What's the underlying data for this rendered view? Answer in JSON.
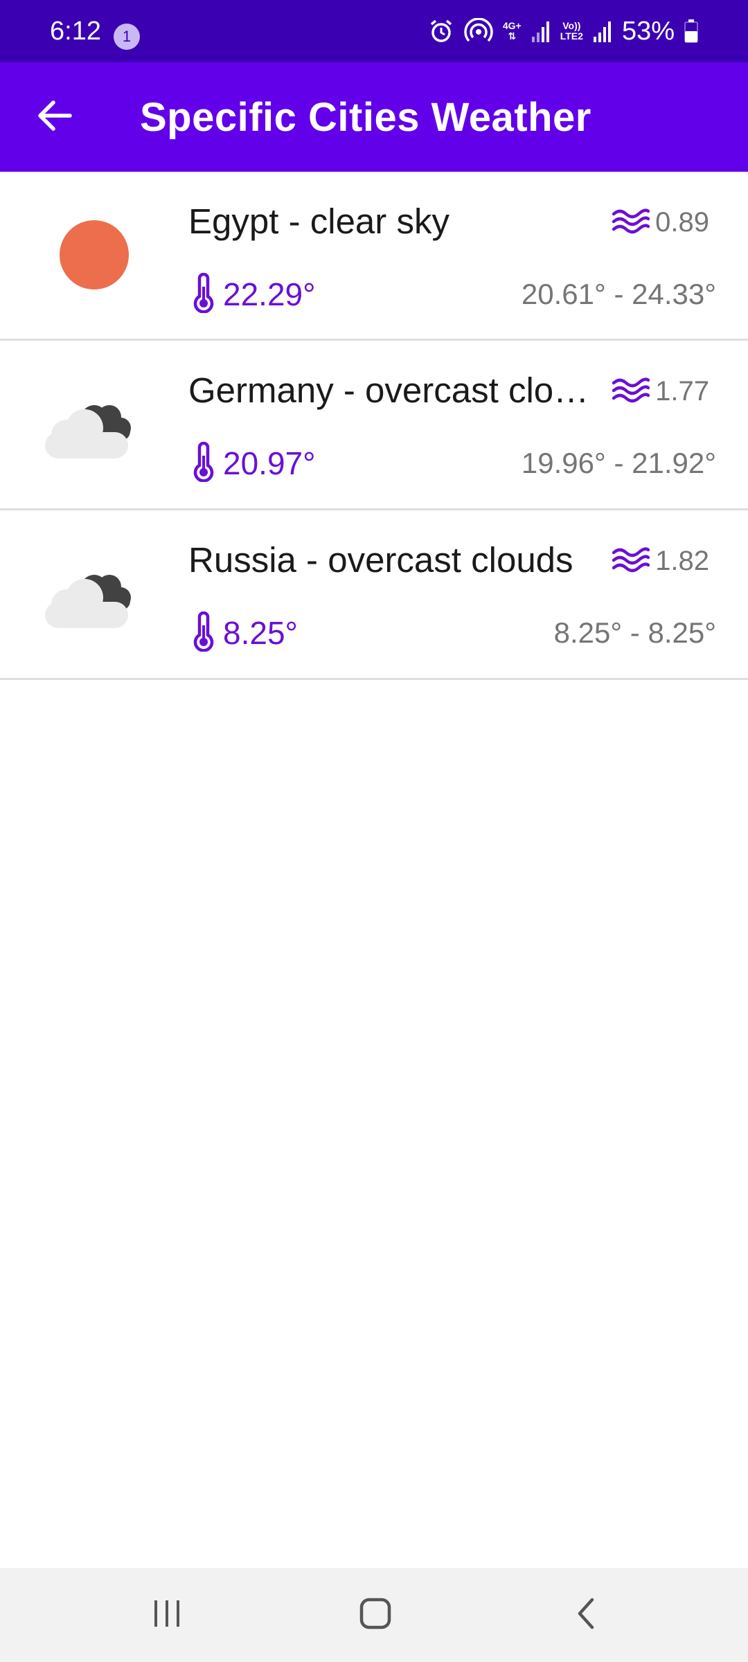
{
  "status_bar": {
    "time": "6:12",
    "notification_count": "1",
    "network_label": "4G+",
    "volte_label": "Vo))",
    "lte_label": "LTE2",
    "battery": "53%",
    "icons": [
      "alarm-icon",
      "hotspot-icon",
      "data-arrows-icon",
      "signal-icon",
      "signal-icon",
      "battery-icon"
    ]
  },
  "app_bar": {
    "title": "Specific Cities Weather",
    "back_icon": "arrow-left-icon"
  },
  "cities": [
    {
      "label": "Egypt - clear sky",
      "icon": "sun-icon",
      "wind": "0.89",
      "temp": "22.29°",
      "range": "20.61° - 24.33°"
    },
    {
      "label": "Germany - overcast clouds",
      "icon": "overcast-cloud-icon",
      "wind": "1.77",
      "temp": "20.97°",
      "range": "19.96° - 21.92°"
    },
    {
      "label": "Russia - overcast clouds",
      "icon": "overcast-cloud-icon",
      "wind": "1.82",
      "temp": "8.25°",
      "range": "8.25° - 8.25°"
    }
  ],
  "nav_bar": {
    "icons": [
      "recent-apps-icon",
      "home-icon",
      "back-icon"
    ]
  },
  "colors": {
    "status_bar": "#3c00b3",
    "app_bar": "#6200ea",
    "accent": "#6a0fd6",
    "sun": "#ec6e4c",
    "secondary_text": "#757575"
  }
}
